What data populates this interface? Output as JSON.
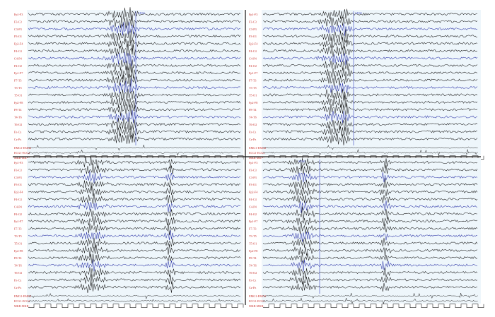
{
  "colors": {
    "trace_black": "#1a1a1a",
    "trace_blue": "#2b33a6",
    "label_red": "#c8322d",
    "marker_blue": "#5560c8",
    "panel_bg": "#eef6fb",
    "divider": "#111111",
    "pulse": "#222222"
  },
  "panels": [
    {
      "id": "top-left",
      "marker_label": "SDSI",
      "channel_labels": [
        "Fp1-F3",
        "F3-C3",
        "C3-P3",
        "P3-O1",
        "Fp2-F4",
        "F4-C4",
        "C4-P4",
        "P4-O2",
        "Fp1-F7",
        "F7-T3",
        "T3-T5",
        "T5-O1",
        "Fp2-F8",
        "F8-T4",
        "T4-T6",
        "T6-O2",
        "Fz-Cz",
        "Cz-Pz"
      ],
      "blue_channels": [
        2,
        6,
        10,
        14
      ],
      "aux_labels": [
        "EMG1-EMG2",
        "ECG1-ECG2",
        "MKR-MKR-"
      ]
    },
    {
      "id": "top-right",
      "marker_label": "SDSI",
      "channel_labels": [
        "Fp1-F3",
        "F3-C3",
        "C3-P3",
        "P3-O1",
        "Fp2-F4",
        "F4-C4",
        "C4-P4",
        "P4-O2",
        "Fp1-F7",
        "F7-T3",
        "T3-T5",
        "T5-O1",
        "Fp2-F8",
        "F8-T4",
        "T4-T6",
        "T6-O2",
        "Fz-Cz",
        "Cz-Pz"
      ],
      "blue_channels": [
        2,
        6,
        10,
        14
      ],
      "aux_labels": [
        "EMG1-EMG2",
        "ECG1-ECG2",
        "MKR-MKR-"
      ]
    },
    {
      "id": "bottom-left",
      "marker_label": "",
      "channel_labels": [
        "Fp1-F3",
        "F3-C3",
        "C3-P3",
        "P3-O1",
        "Fp2-F4",
        "F4-C4",
        "C4-P4",
        "P4-O2",
        "Fp1-F7",
        "F7-T3",
        "T3-T5",
        "T5-O1",
        "Fp2-F8",
        "F8-T4",
        "T4-T6",
        "T6-O2",
        "Fz-Cz",
        "Cz-Pz"
      ],
      "blue_channels": [
        2,
        6,
        10,
        14
      ],
      "aux_labels": [
        "EMG1-EMG2",
        "ECG1-ECG2",
        "MKR-MKR-"
      ]
    },
    {
      "id": "bottom-right",
      "marker_label": "SDSI",
      "channel_labels": [
        "Fp1-F3",
        "F3-C3",
        "C3-P3",
        "P3-O1",
        "Fp2-F4",
        "F4-C4",
        "C4-P4",
        "P4-O2",
        "Fp1-F7",
        "F7-T3",
        "T3-T5",
        "T5-O1",
        "Fp2-F8",
        "F8-T4",
        "T4-T6",
        "T6-O2",
        "Fz-Cz",
        "Cz-Pz"
      ],
      "blue_channels": [
        2,
        6,
        10,
        14
      ],
      "aux_labels": [
        "EMG1-EMG2",
        "ECG1-ECG2",
        "MKR-MKR-"
      ]
    }
  ]
}
